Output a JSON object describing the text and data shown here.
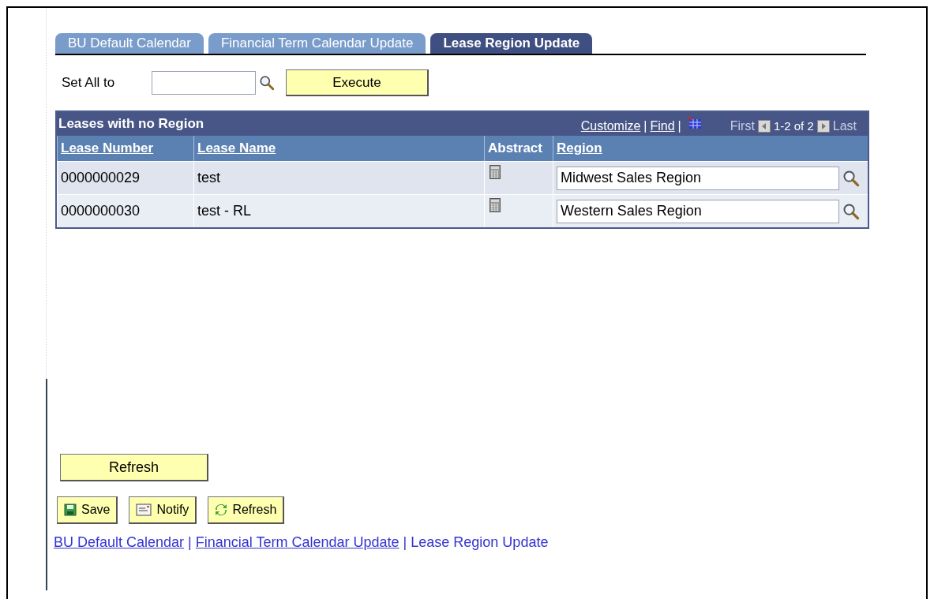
{
  "tabs": [
    {
      "label": "BU Default Calendar",
      "selected": false
    },
    {
      "label": "Financial Term Calendar Update",
      "selected": false
    },
    {
      "label": "Lease Region Update",
      "selected": true
    }
  ],
  "set_all": {
    "label": "Set All to",
    "button": "Execute"
  },
  "grid": {
    "title": "Leases with no Region",
    "customize": "Customize",
    "separator": "|",
    "find": "Find",
    "first": "First",
    "range": "1-2 of 2",
    "last": "Last",
    "columns": [
      "Lease Number",
      "Lease Name",
      "Abstract",
      "Region"
    ],
    "rows": [
      {
        "lease_number": "0000000029",
        "lease_name": "test",
        "region": "Midwest Sales Region"
      },
      {
        "lease_number": "0000000030",
        "lease_name": "test - RL",
        "region": "Western Sales Region"
      }
    ]
  },
  "refresh_button": "Refresh",
  "toolbar": [
    {
      "kind": "save",
      "label": "Save"
    },
    {
      "kind": "notify",
      "label": "Notify"
    },
    {
      "kind": "refresh",
      "label": "Refresh"
    }
  ],
  "footer_separator": "|",
  "footer_links": [
    {
      "label": "BU Default Calendar",
      "selected": false
    },
    {
      "label": "Financial Term Calendar Update",
      "selected": false
    },
    {
      "label": "Lease Region Update",
      "selected": true
    }
  ]
}
